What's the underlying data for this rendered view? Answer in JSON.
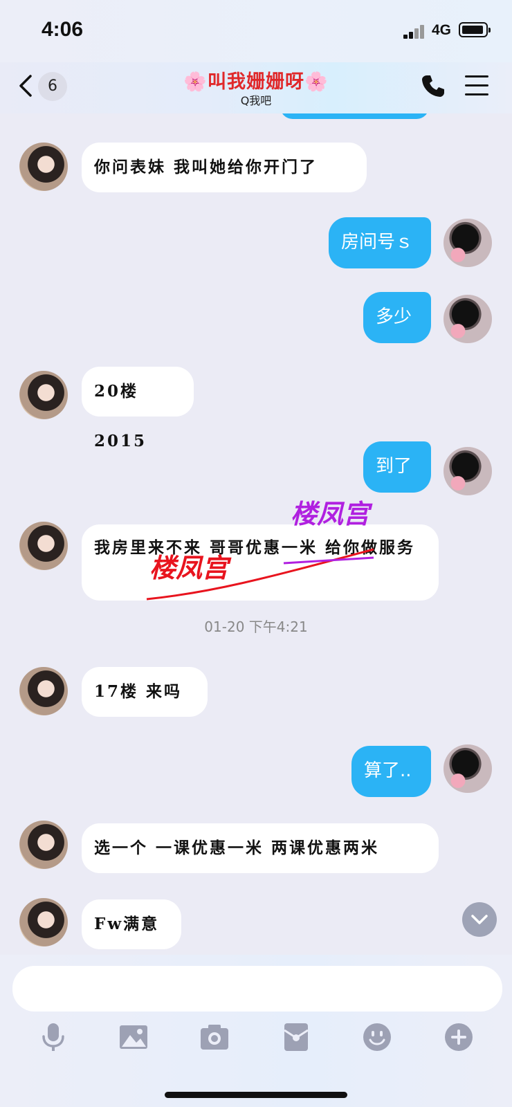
{
  "status_bar": {
    "time": "4:06",
    "network": "4G"
  },
  "header": {
    "unread_count": "6",
    "title": "🌸叫我姗姗呀🌸",
    "subtitle": "Q我吧"
  },
  "messages": [
    {
      "from": "her",
      "text": "你问表妹 我叫她给你开门了"
    },
    {
      "from": "me",
      "text": "房间号ｓ"
    },
    {
      "from": "me",
      "text": "多少"
    },
    {
      "from": "her",
      "text": "20楼2015"
    },
    {
      "from": "me",
      "text": "到了"
    },
    {
      "from": "her",
      "text": "我房里来不来 哥哥优惠一米 给你做服务"
    },
    {
      "from": "her",
      "text": "17楼 来吗"
    },
    {
      "from": "me",
      "text": "算了.."
    },
    {
      "from": "her",
      "text": "选一个 一课优惠一米 两课优惠两米"
    },
    {
      "from": "her",
      "text": "Fw满意"
    }
  ],
  "timestamp": "01-20 下午4:21",
  "watermarks": [
    "楼凤宫",
    "楼凤宫"
  ],
  "toolbar": [
    "microphone-icon",
    "image-icon",
    "camera-icon",
    "red-packet-icon",
    "emoji-icon",
    "plus-icon"
  ],
  "colors": {
    "outgoing_bubble": "#2bb3f5",
    "title": "#e0282a",
    "watermark_red": "#e8141e",
    "watermark_purple": "#b020e0"
  }
}
